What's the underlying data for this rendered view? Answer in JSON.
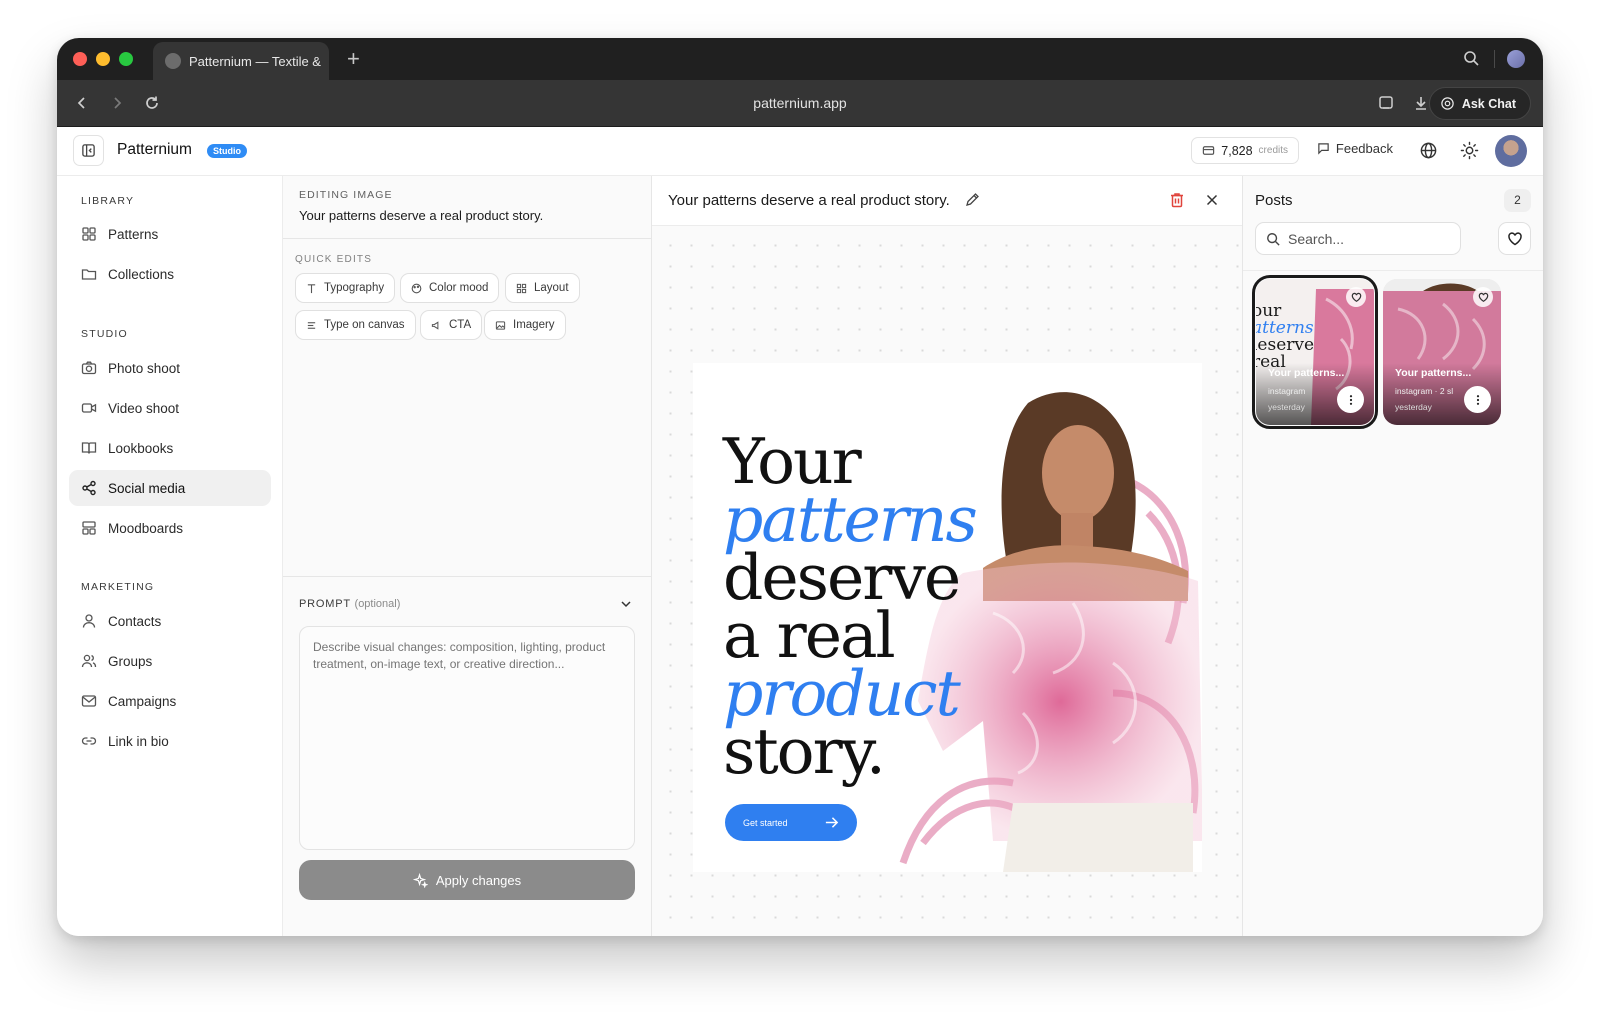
{
  "browser": {
    "tab_title": "Patternium — Textile &",
    "url": "patternium.app",
    "ask_chat": "Ask Chat"
  },
  "header": {
    "brand": "Patternium",
    "badge": "Studio",
    "credits_value": "7,828",
    "credits_unit": "credits",
    "feedback": "Feedback"
  },
  "sidebar": {
    "sections": [
      {
        "title": "LIBRARY",
        "items": [
          "Patterns",
          "Collections"
        ]
      },
      {
        "title": "STUDIO",
        "items": [
          "Photo shoot",
          "Video shoot",
          "Lookbooks",
          "Social media",
          "Moodboards"
        ]
      },
      {
        "title": "MARKETING",
        "items": [
          "Contacts",
          "Groups",
          "Campaigns",
          "Link in bio"
        ]
      }
    ],
    "active_item": "Social media"
  },
  "editor": {
    "label": "EDITING IMAGE",
    "title": "Your patterns deserve a real product story.",
    "quick_edits_label": "QUICK EDITS",
    "quick_edits": [
      "Typography",
      "Color mood",
      "Layout",
      "Type on canvas",
      "CTA",
      "Imagery"
    ],
    "prompt_label": "PROMPT",
    "prompt_optional": "(optional)",
    "prompt_placeholder": "Describe visual changes: composition, lighting, product treatment, on-image text, or creative direction...",
    "apply_label": "Apply changes"
  },
  "canvas": {
    "title": "Your patterns deserve a real product story.",
    "poster_lines": [
      "Your",
      "patterns",
      "deserve",
      "a real",
      "product",
      "story."
    ],
    "poster_cta": "Get started",
    "accent_color": "#2f7ff0"
  },
  "posts": {
    "title": "Posts",
    "count": "2",
    "search_placeholder": "Search...",
    "cards": [
      {
        "title": "Your patterns...",
        "platform": "instagram",
        "time": "yesterday"
      },
      {
        "title": "Your patterns...",
        "platform": "instagram · 2 sl",
        "time": "yesterday"
      }
    ]
  }
}
